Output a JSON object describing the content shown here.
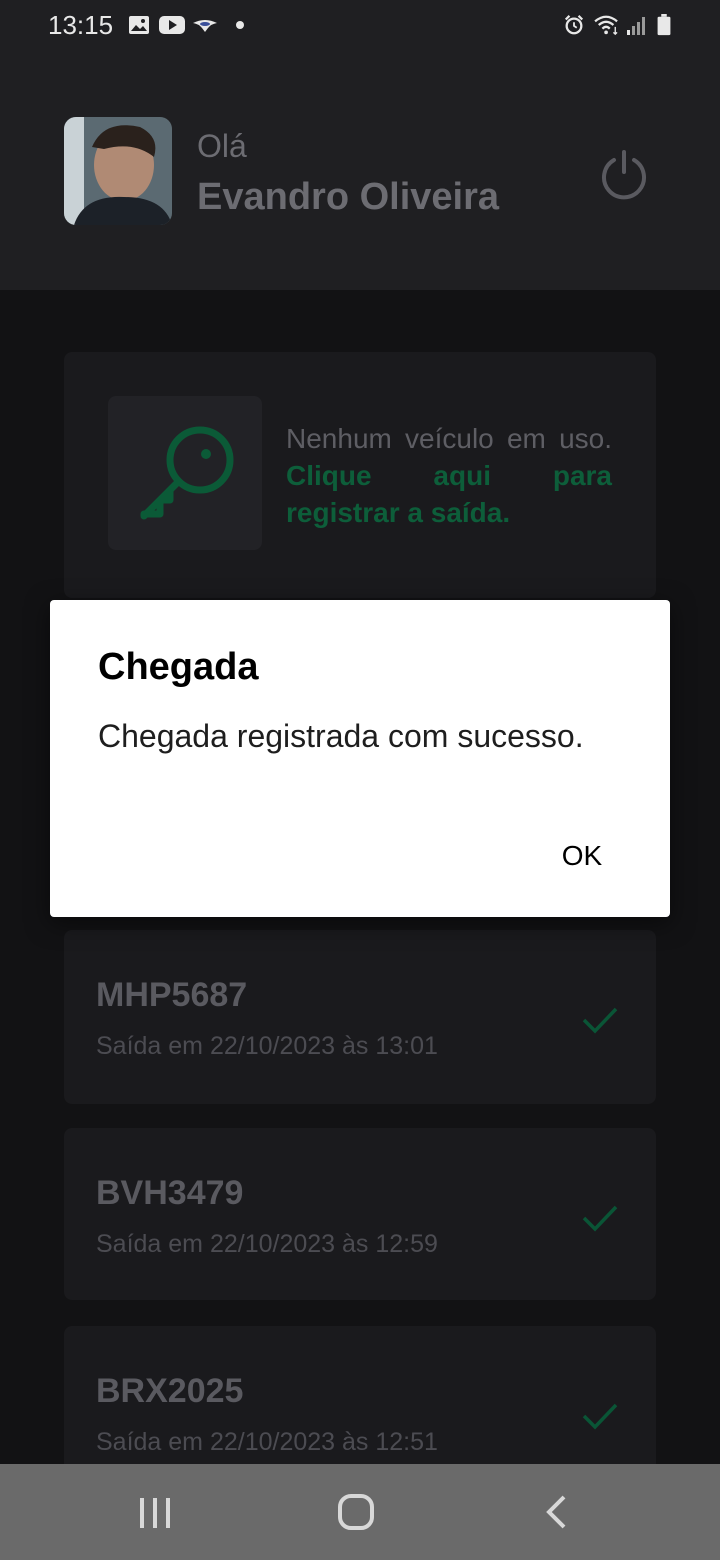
{
  "status_bar": {
    "time": "13:15",
    "left_icons": [
      "gallery-icon",
      "youtube-icon",
      "app-icon",
      "dot-icon"
    ],
    "right_icons": [
      "alarm-icon",
      "wifi-icon",
      "signal-icon",
      "battery-icon"
    ]
  },
  "header": {
    "greeting": "Olá",
    "user_name": "Evandro Oliveira",
    "power_icon": "power-icon"
  },
  "no_vehicle_card": {
    "text": "Nenhum veículo em uso.",
    "link": "Clique aqui para registrar a saída.",
    "icon": "key-icon",
    "accent": "#00875F"
  },
  "vehicles": [
    {
      "plate": "MHP5687",
      "info": "Saída em 22/10/2023 às 13:01"
    },
    {
      "plate": "BVH3479",
      "info": "Saída em 22/10/2023 às 12:59"
    },
    {
      "plate": "BRX2025",
      "info": "Saída em 22/10/2023 às 12:51"
    }
  ],
  "dialog": {
    "title": "Chegada",
    "message": "Chegada registrada com sucesso.",
    "ok_label": "OK"
  },
  "nav_bar": {
    "icons": [
      "recents-icon",
      "home-icon",
      "back-icon"
    ]
  }
}
